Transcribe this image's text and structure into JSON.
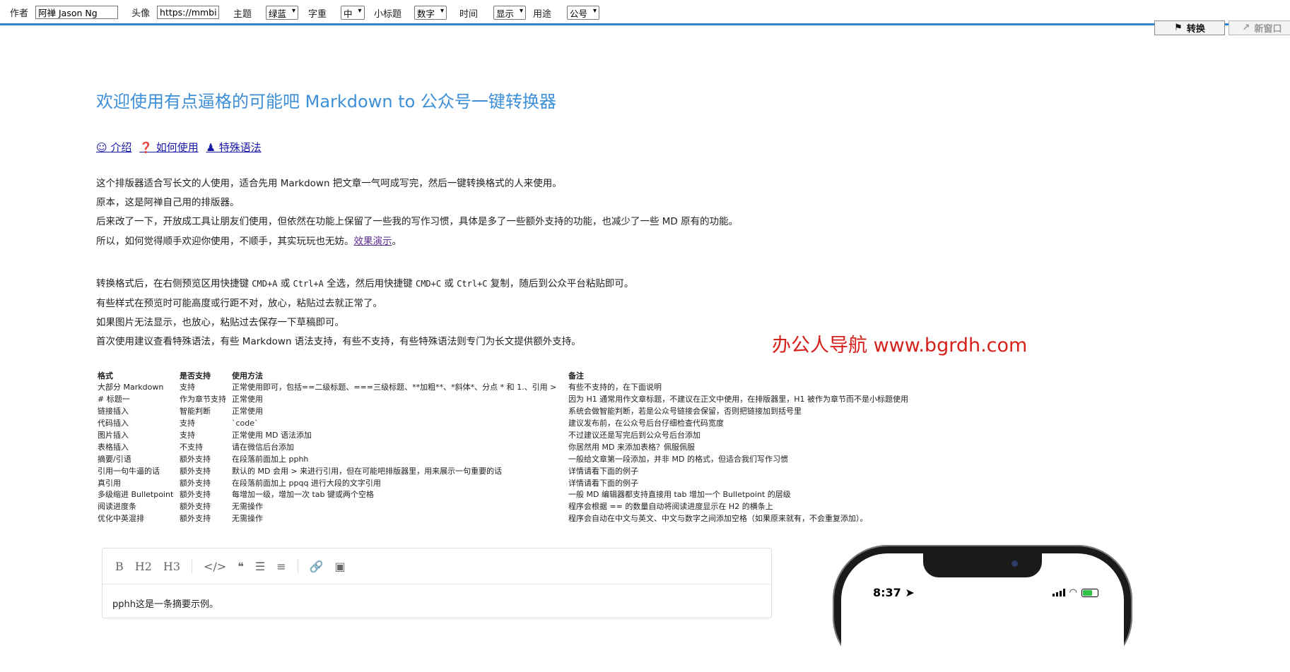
{
  "toolbar": {
    "author_label": "作者",
    "author_value": "阿禅 Jason Ng",
    "avatar_label": "头像",
    "avatar_value": "https://mmbiz.",
    "theme_label": "主题",
    "theme_value": "绿蓝",
    "fontsize_label": "字重",
    "fontsize_value": "中",
    "subtitle_label": "小标题",
    "subtitle_value": "数字",
    "time_label": "时间",
    "time_value": "显示",
    "usage_label": "用途",
    "usage_value": "公号",
    "convert_label": "转换",
    "newwin_label": "新窗口"
  },
  "page": {
    "title": "欢迎使用有点逼格的可能吧 Markdown to 公众号一键转换器",
    "links": {
      "intro": "介绍",
      "howto": "如何使用",
      "syntax": "特殊语法"
    },
    "paragraphs1": [
      "这个排版器适合写长文的人使用，适合先用 Markdown 把文章一气呵成写完，然后一键转换格式的人来使用。",
      "原本，这是阿禅自己用的排版器。",
      "后来改了一下，开放成工具让朋友们使用，但依然在功能上保留了一些我的写作习惯，具体是多了一些额外支持的功能，也减少了一些 MD 原有的功能。"
    ],
    "para1_last_prefix": "所以，如何觉得顺手欢迎你使用，不顺手，其实玩玩也无妨。",
    "para1_last_link": "效果演示",
    "para1_last_suffix": "。",
    "copy_hint": {
      "a": "转换格式后，在右侧预览区用快捷键 ",
      "k1": "CMD+A",
      "b": " 或 ",
      "k2": "Ctrl+A",
      "c": " 全选，然后用快捷键 ",
      "k3": "CMD+C",
      "d": " 或 ",
      "k4": "Ctrl+C",
      "e": " 复制，随后到公众平台粘贴即可。"
    },
    "paragraphs2": [
      "有些样式在预览时可能高度或行距不对，放心，粘贴过去就正常了。",
      "如果图片无法显示，也放心，粘贴过去保存一下草稿即可。",
      "首次使用建议查看特殊语法，有些 Markdown 语法支持，有些不支持，有些特殊语法则专门为长文提供额外支持。"
    ],
    "watermark": "办公人导航 www.bgrdh.com"
  },
  "table": {
    "headers": [
      "格式",
      "是否支持",
      "使用方法",
      "备注"
    ],
    "rows": [
      [
        "大部分 Markdown",
        "支持",
        "正常使用即可，包括==二级标题、===三级标题、**加粗**、*斜体*、分点 * 和 1.、引用 >",
        "有些不支持的，在下面说明"
      ],
      [
        "# 标题一",
        "作为章节支持",
        "正常使用",
        "因为 H1 通常用作文章标题，不建议在正文中使用，在排版器里，H1 被作为章节而不是小标题使用"
      ],
      [
        "链接插入",
        "智能判断",
        "正常使用",
        "系统会做智能判断，若是公众号链接会保留，否则把链接加到括号里"
      ],
      [
        "代码插入",
        "支持",
        "`code`",
        "建议发布前，在公众号后台仔细检查代码宽度"
      ],
      [
        "图片插入",
        "支持",
        "正常使用 MD 语法添加",
        "不过建议还是写完后到公众号后台添加"
      ],
      [
        "表格插入",
        "不支持",
        "请在微信后台添加",
        "你居然用 MD 来添加表格？佩服佩服"
      ],
      [
        "摘要/引语",
        "额外支持",
        "在段落前面加上 pphh",
        "一般给文章第一段添加，并非 MD 的格式，但适合我们写作习惯"
      ],
      [
        "引用一句牛逼的话",
        "额外支持",
        "默认的 MD 会用 > 来进行引用，但在可能吧排版器里，用来展示一句重要的话",
        "详情请看下面的例子"
      ],
      [
        "真引用",
        "额外支持",
        "在段落前面加上 ppqq 进行大段的文字引用",
        "详情请看下面的例子"
      ],
      [
        "多级缩进 Bulletpoint",
        "额外支持",
        "每增加一级，增加一次 tab 键或两个空格",
        "一般 MD 编辑器都支持直接用 tab 增加一个 Bulletpoint 的层级"
      ],
      [
        "阅读进度条",
        "额外支持",
        "无需操作",
        "程序会根据 == 的数量自动将阅读进度显示在 H2 的横条上"
      ],
      [
        "优化中英混排",
        "额外支持",
        "无需操作",
        "程序会自动在中文与英文、中文与数字之间添加空格（如果原来就有，不会重复添加）。"
      ]
    ]
  },
  "editor": {
    "toolbar": {
      "bold": "B",
      "h2": "H2",
      "h3": "H3"
    },
    "first_line": "pphh这是一条摘要示例。"
  },
  "phone": {
    "time": "8:37"
  }
}
